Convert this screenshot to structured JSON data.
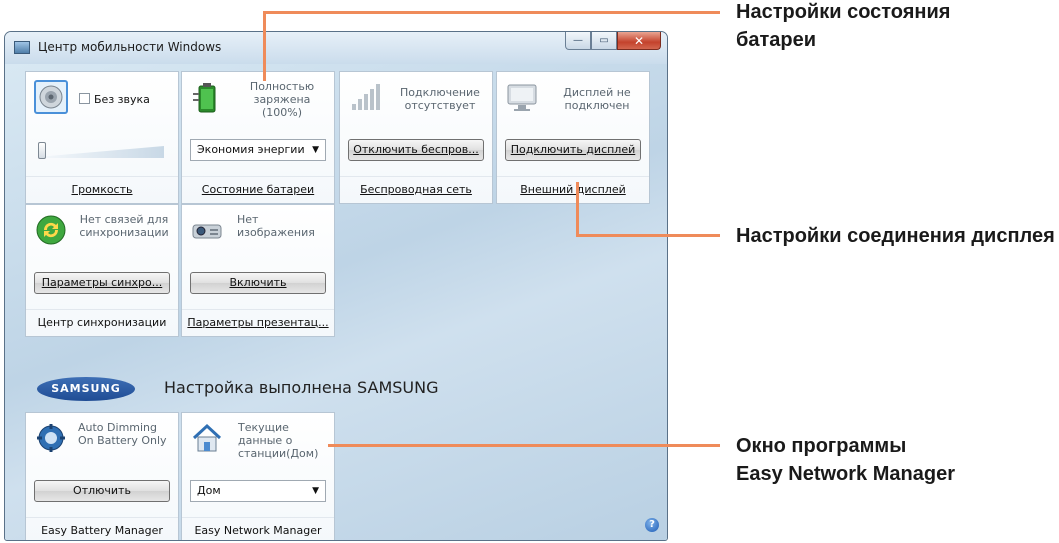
{
  "window": {
    "title": "Центр мобильности Windows"
  },
  "caption_buttons": {
    "minimize": "—",
    "maximize": "▭",
    "close": "✕"
  },
  "tiles": {
    "volume": {
      "checkbox_label": "Без звука",
      "muted": false,
      "level": 0.05,
      "caption": "Громкость"
    },
    "battery": {
      "status": "Полностью заряжена (100%)",
      "plan": "Экономия энергии",
      "caption": "Состояние батареи"
    },
    "wireless": {
      "status": "Подключение отсутствует",
      "button": "Отключить беспров...",
      "caption": "Беспроводная сеть"
    },
    "display": {
      "status": "Дисплей не подключен",
      "button": "Подключить дисплей",
      "caption": "Внешний дисплей"
    },
    "sync": {
      "status": "Нет связей для синхронизации",
      "button": "Параметры синхро...",
      "caption": "Центр синхронизации"
    },
    "presentation": {
      "status": "Нет изображения",
      "button": "Включить",
      "caption": "Параметры презентац..."
    }
  },
  "samsung": {
    "logo_text": "SAMSUNG",
    "title": "Настройка выполнена SAMSUNG"
  },
  "samsung_tiles": {
    "battery_manager": {
      "status": "Auto Dimming On Battery Only",
      "button": "Отлючить",
      "caption": "Easy Battery Manager"
    },
    "network_manager": {
      "status": "Текущие данные о станции(Дом)",
      "select_value": "Дом",
      "caption": "Easy Network Manager"
    }
  },
  "help": {
    "label": "?"
  },
  "callouts": {
    "battery": "Настройки состояния батареи",
    "display": "Настройки соединения дисплея",
    "network": "Окно программы Easy Network Manager"
  },
  "colors": {
    "callout": "#ef8b5a",
    "titlebar_close": "#c4422c",
    "window_bg": "#c8dbea"
  }
}
